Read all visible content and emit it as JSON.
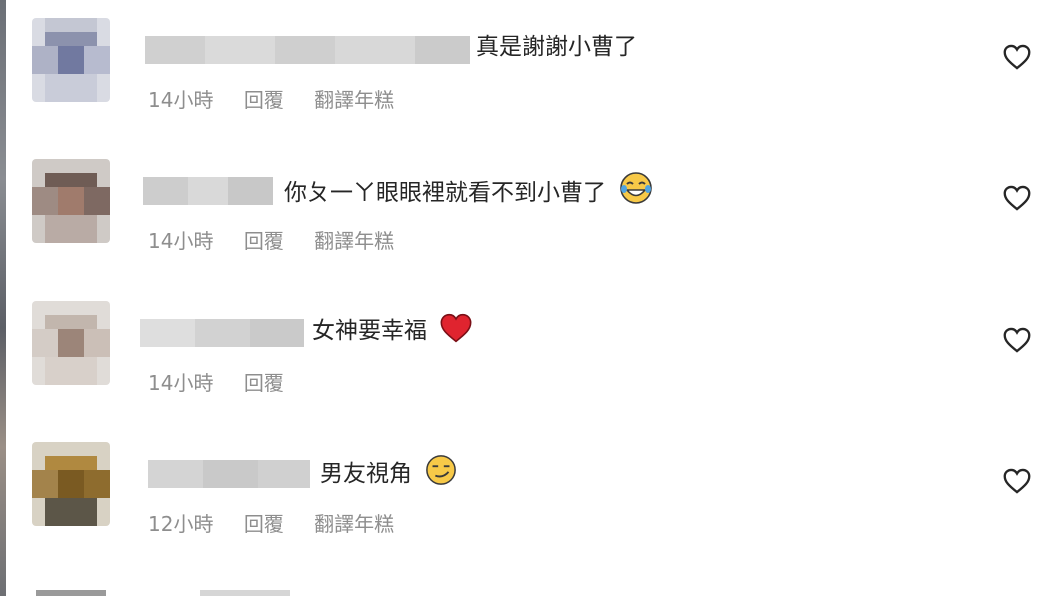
{
  "comments": [
    {
      "text": "真是謝謝小曹了",
      "time": "14小時",
      "reply": "回覆",
      "translate": "翻譯年糕",
      "emoji": ""
    },
    {
      "text": "你ㄆ一ㄚ眼眼裡就看不到小曹了",
      "time": "14小時",
      "reply": "回覆",
      "translate": "翻譯年糕",
      "emoji": "tears-of-joy-emoji"
    },
    {
      "text": "女神要幸福",
      "time": "14小時",
      "reply": "回覆",
      "translate": "",
      "emoji": "red-heart-emoji"
    },
    {
      "text": "男友視角",
      "time": "12小時",
      "reply": "回覆",
      "translate": "翻譯年糕",
      "emoji": "smirk-emoji"
    }
  ],
  "icons": {
    "like": "heart-outline-icon"
  },
  "colors": {
    "text": "#262626",
    "meta": "#8e8e8e",
    "heart": "#262626",
    "emoji_heart": "#e0242f",
    "emoji_face": "#f7c948"
  }
}
